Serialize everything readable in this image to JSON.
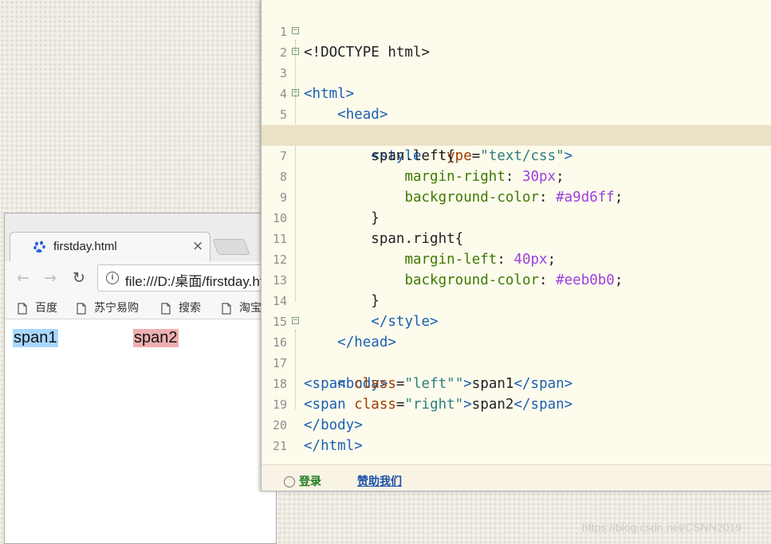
{
  "browser": {
    "tab_title": "firstday.html",
    "tab_close": "×",
    "url": "file:///D:/桌面/firstday.html",
    "info_symbol": "i",
    "nav": {
      "back": "←",
      "forward": "→",
      "reload": "↻"
    },
    "bookmarks": [
      {
        "label": "百度",
        "icon": "page-icon"
      },
      {
        "label": "苏宁易购",
        "icon": "page-icon"
      },
      {
        "label": "搜索",
        "icon": "page-icon"
      },
      {
        "label": "淘宝",
        "icon": "page-icon"
      }
    ],
    "content": {
      "span1": "span1",
      "span2": "span2"
    },
    "colors": {
      "span1_bg": "#a9d6ff",
      "span2_bg": "#eeb0b0"
    }
  },
  "editor": {
    "active_line": 7,
    "lines": [
      {
        "n": "1",
        "fold": ""
      },
      {
        "n": "2",
        "fold": "⊟"
      },
      {
        "n": "3",
        "fold": "⊟"
      },
      {
        "n": "4",
        "fold": ""
      },
      {
        "n": "5",
        "fold": "⊟"
      },
      {
        "n": "6",
        "fold": ""
      },
      {
        "n": "7",
        "fold": ""
      },
      {
        "n": "8",
        "fold": ""
      },
      {
        "n": "9",
        "fold": ""
      },
      {
        "n": "10",
        "fold": ""
      },
      {
        "n": "11",
        "fold": ""
      },
      {
        "n": "12",
        "fold": ""
      },
      {
        "n": "13",
        "fold": ""
      },
      {
        "n": "14",
        "fold": ""
      },
      {
        "n": "15",
        "fold": ""
      },
      {
        "n": "16",
        "fold": "⊟"
      },
      {
        "n": "17",
        "fold": ""
      },
      {
        "n": "18",
        "fold": ""
      },
      {
        "n": "19",
        "fold": ""
      },
      {
        "n": "20",
        "fold": ""
      },
      {
        "n": "21",
        "fold": ""
      }
    ],
    "code": {
      "l1": {
        "a": "<!DOCTYPE html>"
      },
      "l2": {
        "a": "<html>"
      },
      "l3": {
        "indent": "    ",
        "a": "<head>"
      },
      "l5": {
        "indent": "        ",
        "a": "<style",
        "sp": "  ",
        "attr": "type",
        "eq": "=",
        "str": "\"text/css\"",
        "b": ">"
      },
      "l6": {
        "indent": "        ",
        "a": "span.left{"
      },
      "l7": {
        "indent": "            ",
        "prop": "margin-right",
        "colon": ": ",
        "val": "30px",
        "semi": ";"
      },
      "l8": {
        "indent": "            ",
        "prop": "background-color",
        "colon": ": ",
        "val": "#a9d6ff",
        "semi": ";"
      },
      "l9": {
        "indent": "        ",
        "a": "}"
      },
      "l10": {
        "indent": "        ",
        "a": "span.right{"
      },
      "l11": {
        "indent": "            ",
        "prop": "margin-left",
        "colon": ": ",
        "val": "40px",
        "semi": ";"
      },
      "l12": {
        "indent": "            ",
        "prop": "background-color",
        "colon": ": ",
        "val": "#eeb0b0",
        "semi": ";"
      },
      "l13": {
        "indent": "        ",
        "a": "}"
      },
      "l14": {
        "indent": "        ",
        "a": "</style>"
      },
      "l15": {
        "indent": "    ",
        "a": "</head>"
      },
      "l16": {
        "indent": "    ",
        "a": "<body>"
      },
      "l17": {
        "open": "<span",
        "sp": " ",
        "attr": "class",
        "eq": "=",
        "str": "\"left\"",
        "extra": "\"",
        "b": ">",
        "txt": "span1",
        "close": "</span>"
      },
      "l18": {
        "open": "<span",
        "sp": " ",
        "attr": "class",
        "eq": "=",
        "str": "\"right\"",
        "b": ">",
        "txt": "span2",
        "close": "</span>"
      },
      "l19": {
        "a": "</body>"
      },
      "l20": {
        "a": "</html>"
      }
    },
    "status": {
      "login": "登录",
      "sponsor": "赞助我们"
    }
  },
  "watermark": "https://blog.csdn.net/CSNN2019"
}
